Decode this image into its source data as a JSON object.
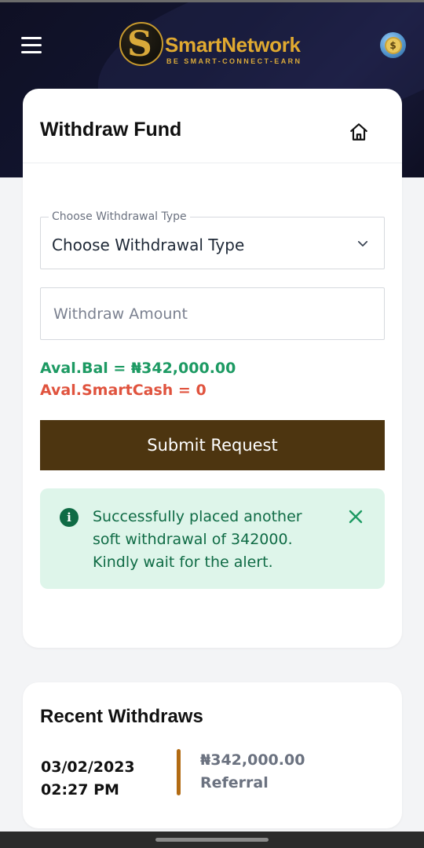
{
  "header": {
    "brand": {
      "name": "SmartNetwork",
      "tagline": "BE SMART-CONNECT-EARN",
      "mark": "S"
    },
    "menu_icon": "hamburger-menu-icon",
    "wallet_icon": "coin-icon",
    "coin_symbol": "$"
  },
  "withdraw": {
    "title": "Withdraw Fund",
    "home_icon": "home-icon",
    "select": {
      "legend": "Choose Withdrawal Type",
      "value": "Choose Withdrawal Type"
    },
    "amount": {
      "placeholder": "Withdraw Amount",
      "value": ""
    },
    "balance_text": "Aval.Bal = ₦342,000.00",
    "smartcash_text": "Aval.SmartCash = 0",
    "submit_label": "Submit Request",
    "alert": {
      "message": "Successfully placed another soft withdrawal of 342000. Kindly wait for the alert.",
      "icon_glyph": "i"
    }
  },
  "recent": {
    "title": "Recent Withdraws",
    "items": [
      {
        "date": "03/02/2023",
        "time": "02:27 PM",
        "amount": "₦342,000.00",
        "type": "Referral"
      }
    ]
  },
  "colors": {
    "header_bg": "#121530",
    "brand_gold": "#e0a930",
    "submit_bg": "#4d3510",
    "balance_green": "#1d9a63",
    "smartcash_red": "#e0533e",
    "alert_bg": "#def5ea",
    "alert_text": "#0f6b45",
    "recent_bar": "#b26b13"
  }
}
